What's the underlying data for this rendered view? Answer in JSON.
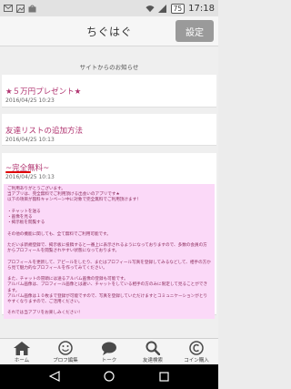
{
  "status_bar": {
    "battery": "75",
    "time": "17:18",
    "icons": [
      "mail-icon",
      "image-icon",
      "bag-icon",
      "wifi-icon",
      "signal-icon",
      "battery-icon"
    ]
  },
  "header": {
    "title": "ちぐはぐ",
    "settings_label": "設定"
  },
  "section_label": "サイトからのお知らせ",
  "notices": [
    {
      "title": "★５万円プレゼント★",
      "date": "2016/04/25 10:23"
    },
    {
      "title": "友達リストの追加方法",
      "date": "2016/04/25 10:13"
    },
    {
      "title": "~完全無料~",
      "date": "2016/04/25 10:13",
      "body": "ご利用ありがとうございます。\n当アプリは、完全無料でご利用頂ける出会いのアプリです★\n以下の項目が無料キャンペーン中に対象で完全無料でご利用頂けます！\n\n・チャットを送る\n・画像を見る\n・掲示板を閲覧する\n\nその他の機能に関しても、全て無料でご利用可能です。\n\nただいま新規登録で、掲示板に投稿すると一番上に表示されるようになっておりますので、多数の会員の方からプロフィールを閲覧されやすい状態になっております。\n\nプロフィールを更新して、アピールをしたり、またはプロフィール写真を登録してみるなどして、相手の方から見て魅力的なプロフィールを作ってみてください。\n\nまた、チャットの冒頭には送るアルバム画像の登録も可能です。\nアルバム画像は、プロフィール画像とは違い、チャットをしている相手の方のみに限定して見ることができます。\nアルバム画像は１０枚まで登録が可能ですので、写真を登録していただけますとコミュニケーションがとりやすくなりますので、ご活用ください。\n\nそれでは当アプリをお楽しみください！"
    }
  ],
  "bottom_nav": [
    {
      "label": "ホーム",
      "icon": "home-icon"
    },
    {
      "label": "プロフ編集",
      "icon": "smiley-icon"
    },
    {
      "label": "トーク",
      "icon": "chat-bubble-icon"
    },
    {
      "label": "友達検索",
      "icon": "search-icon"
    },
    {
      "label": "コイン購入",
      "icon": "coin-icon"
    }
  ],
  "system_nav": [
    "back-icon",
    "home-circle-icon",
    "recents-icon"
  ],
  "colors": {
    "accent": "#b0326f",
    "notice_body_bg": "#fbd9f8",
    "underline": "#e00000"
  }
}
